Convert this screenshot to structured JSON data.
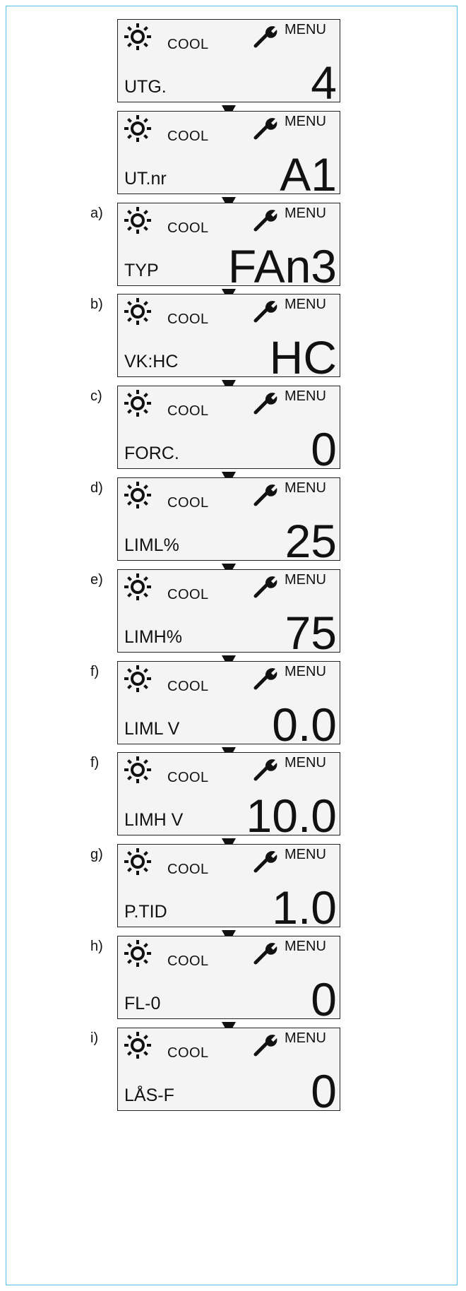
{
  "screens": [
    {
      "tag": "",
      "mode": "COOL",
      "menu": "MENU",
      "param": "UTG.",
      "value": "4"
    },
    {
      "tag": "",
      "mode": "COOL",
      "menu": "MENU",
      "param": "UT.nr",
      "value": "A1"
    },
    {
      "tag": "a)",
      "mode": "COOL",
      "menu": "MENU",
      "param": "TYP",
      "value": "FAn3"
    },
    {
      "tag": "b)",
      "mode": "COOL",
      "menu": "MENU",
      "param": "VK:HC",
      "value": "HC"
    },
    {
      "tag": "c)",
      "mode": "COOL",
      "menu": "MENU",
      "param": "FORC.",
      "value": "0"
    },
    {
      "tag": "d)",
      "mode": "COOL",
      "menu": "MENU",
      "param": "LIML%",
      "value": "25"
    },
    {
      "tag": "e)",
      "mode": "COOL",
      "menu": "MENU",
      "param": "LIMH%",
      "value": "75"
    },
    {
      "tag": "f)",
      "mode": "COOL",
      "menu": "MENU",
      "param": "LIML V",
      "value": "0.0"
    },
    {
      "tag": "f)",
      "mode": "COOL",
      "menu": "MENU",
      "param": "LIMH V",
      "value": "10.0"
    },
    {
      "tag": "g)",
      "mode": "COOL",
      "menu": "MENU",
      "param": "P.TID",
      "value": "1.0"
    },
    {
      "tag": "h)",
      "mode": "COOL",
      "menu": "MENU",
      "param": "FL-0",
      "value": "0"
    },
    {
      "tag": "i)",
      "mode": "COOL",
      "menu": "MENU",
      "param": "LÅS-F",
      "value": "0"
    }
  ],
  "icons": {
    "sun": "sun-icon",
    "wrench": "wrench-icon",
    "arrow": "down-arrow-icon"
  }
}
